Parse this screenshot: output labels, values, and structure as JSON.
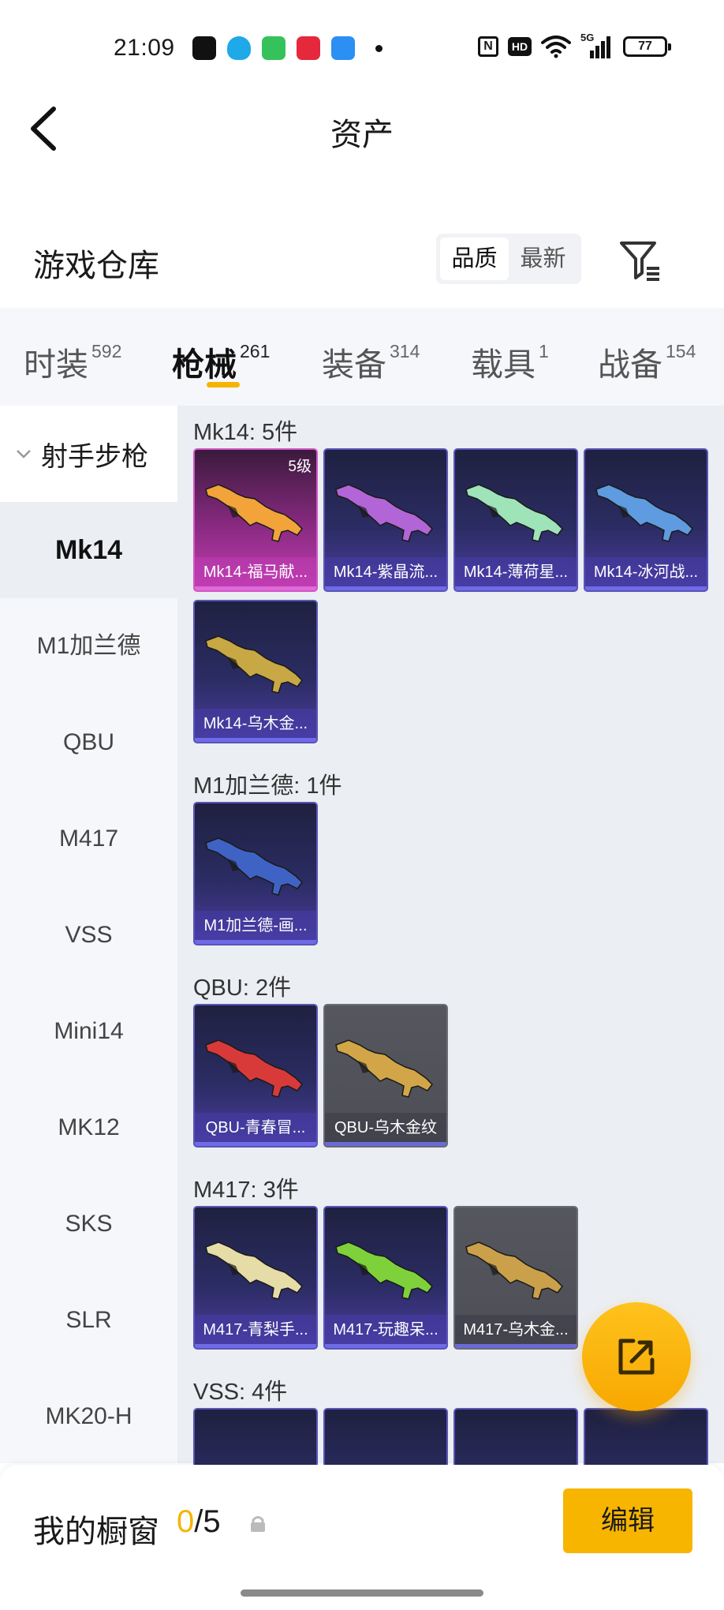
{
  "status_bar": {
    "time": "21:09",
    "battery": "77",
    "hd": "HD",
    "nfc": "N",
    "network": "5G"
  },
  "header": {
    "title": "资产"
  },
  "warehouse": {
    "title": "游戏仓库",
    "sort_options": [
      "品质",
      "最新"
    ],
    "active_sort": "品质"
  },
  "tabs": [
    {
      "label": "时装",
      "count": "592"
    },
    {
      "label": "枪械",
      "count": "261"
    },
    {
      "label": "装备",
      "count": "314"
    },
    {
      "label": "载具",
      "count": "1"
    },
    {
      "label": "战备",
      "count": "154"
    }
  ],
  "sidebar": {
    "group": "射手步枪",
    "items": [
      "Mk14",
      "M1加兰德",
      "QBU",
      "M417",
      "VSS",
      "Mini14",
      "MK12",
      "SKS",
      "SLR",
      "MK20-H"
    ]
  },
  "groups": [
    {
      "title": "Mk14: 5件",
      "items": [
        {
          "name": "Mk14-福马献...",
          "level": "5级",
          "style": "pink",
          "gun_color": "#f2a33a"
        },
        {
          "name": "Mk14-紫晶流...",
          "style": "purple",
          "gun_color": "#b265d6"
        },
        {
          "name": "Mk14-薄荷星...",
          "style": "purple",
          "gun_color": "#9fe3b8"
        },
        {
          "name": "Mk14-冰河战...",
          "style": "purple",
          "gun_color": "#5f9be0"
        },
        {
          "name": "Mk14-乌木金...",
          "style": "purple",
          "gun_color": "#c8a845"
        }
      ]
    },
    {
      "title": "M1加兰德: 1件",
      "items": [
        {
          "name": "M1加兰德-画...",
          "style": "purple",
          "gun_color": "#3f63c4"
        }
      ]
    },
    {
      "title": "QBU: 2件",
      "items": [
        {
          "name": "QBU-青春冒...",
          "style": "purple",
          "gun_color": "#d83a3a"
        },
        {
          "name": "QBU-乌木金纹",
          "style": "grey",
          "gun_color": "#d2a648"
        }
      ]
    },
    {
      "title": "M417: 3件",
      "items": [
        {
          "name": "M417-青梨手...",
          "style": "purple",
          "gun_color": "#e6dca8"
        },
        {
          "name": "M417-玩趣呆...",
          "style": "purple",
          "gun_color": "#7fd13c"
        },
        {
          "name": "M417-乌木金...",
          "style": "grey",
          "gun_color": "#caa04a"
        }
      ]
    },
    {
      "title": "VSS: 4件",
      "items": []
    }
  ],
  "showcase": {
    "label": "我的橱窗",
    "current": "0",
    "total": "/5",
    "edit_label": "编辑"
  }
}
